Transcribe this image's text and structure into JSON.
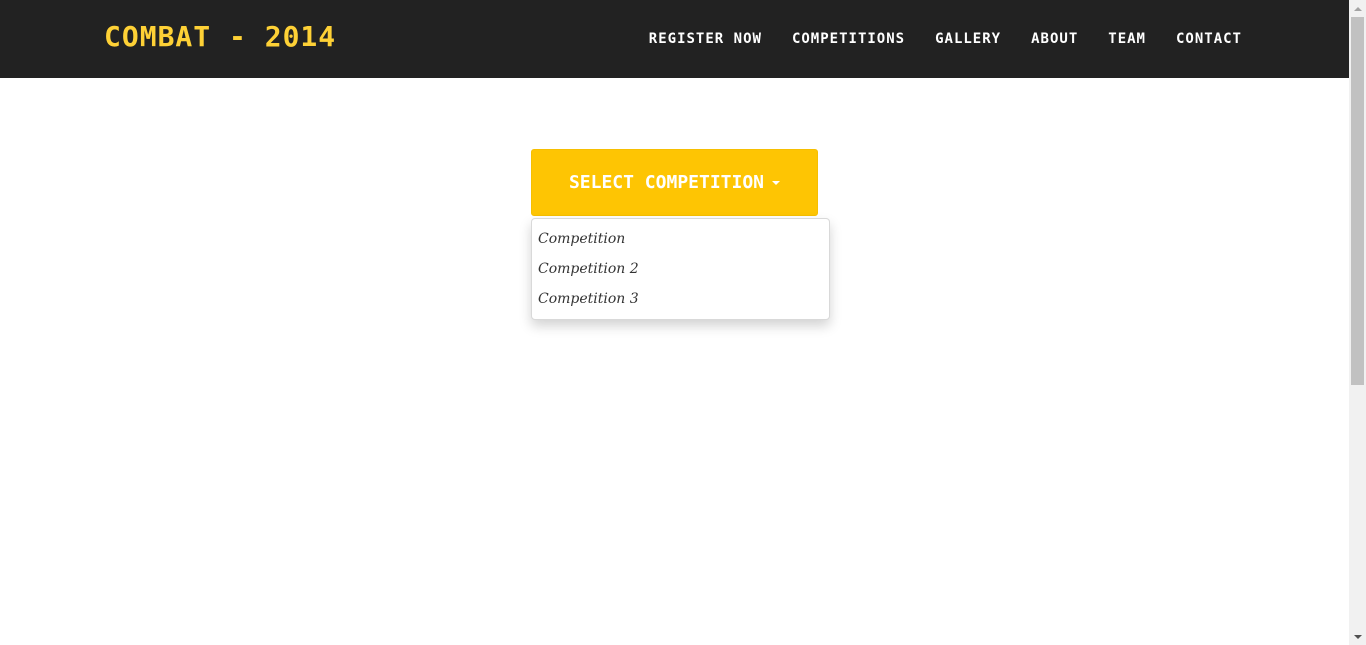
{
  "brand": {
    "title": "COMBAT - 2014"
  },
  "nav": {
    "items": [
      {
        "label": "REGISTER NOW"
      },
      {
        "label": "COMPETITIONS"
      },
      {
        "label": "GALLERY"
      },
      {
        "label": "ABOUT"
      },
      {
        "label": "TEAM"
      },
      {
        "label": "CONTACT"
      }
    ]
  },
  "dropdown": {
    "button_label": "SELECT COMPETITION",
    "options": [
      {
        "label": "Competition"
      },
      {
        "label": "Competition 2"
      },
      {
        "label": "Competition 3"
      }
    ]
  },
  "colors": {
    "navbar_bg": "#222222",
    "brand": "#fed136",
    "button_bg": "#fec503"
  }
}
